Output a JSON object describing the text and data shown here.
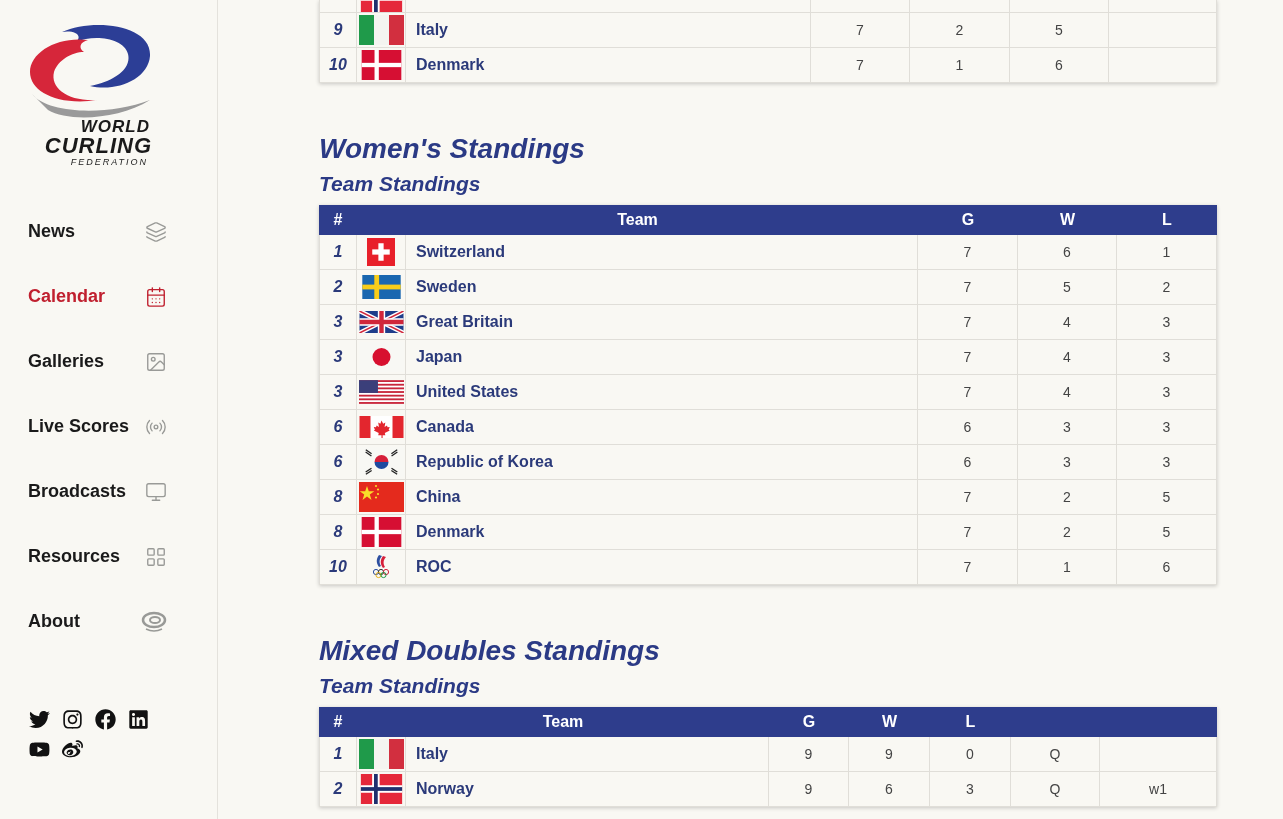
{
  "logo": {
    "line1": "WORLD",
    "line2": "CURLING",
    "line3": "FEDERATION"
  },
  "nav": [
    {
      "label": "News",
      "selected": false
    },
    {
      "label": "Calendar",
      "selected": true
    },
    {
      "label": "Galleries",
      "selected": false
    },
    {
      "label": "Live Scores",
      "selected": false
    },
    {
      "label": "Broadcasts",
      "selected": false
    },
    {
      "label": "Resources",
      "selected": false
    },
    {
      "label": "About",
      "selected": false
    }
  ],
  "men_table": {
    "cut_row": {
      "kind": "no"
    },
    "rows": [
      {
        "kind": "it",
        "cells": [
          "9",
          "Italy",
          "7",
          "2",
          "5"
        ]
      },
      {
        "kind": "dk",
        "cells": [
          "10",
          "Denmark",
          "7",
          "1",
          "6"
        ]
      }
    ]
  },
  "women": {
    "title": "Women's Standings",
    "subtitle": "Team Standings",
    "columns": [
      "#",
      "Team",
      "G",
      "W",
      "L"
    ],
    "rows": [
      {
        "kind": "ch",
        "cells": [
          "1",
          "Switzerland",
          "7",
          "6",
          "1"
        ]
      },
      {
        "kind": "se",
        "cells": [
          "2",
          "Sweden",
          "7",
          "5",
          "2"
        ]
      },
      {
        "kind": "gb",
        "cells": [
          "3",
          "Great Britain",
          "7",
          "4",
          "3"
        ]
      },
      {
        "kind": "jp",
        "cells": [
          "3",
          "Japan",
          "7",
          "4",
          "3"
        ]
      },
      {
        "kind": "us",
        "cells": [
          "3",
          "United States",
          "7",
          "4",
          "3"
        ]
      },
      {
        "kind": "ca",
        "cells": [
          "6",
          "Canada",
          "6",
          "3",
          "3"
        ]
      },
      {
        "kind": "kr",
        "cells": [
          "6",
          "Republic of Korea",
          "6",
          "3",
          "3"
        ]
      },
      {
        "kind": "cn",
        "cells": [
          "8",
          "China",
          "7",
          "2",
          "5"
        ]
      },
      {
        "kind": "dk",
        "cells": [
          "8",
          "Denmark",
          "7",
          "2",
          "5"
        ]
      },
      {
        "kind": "roc",
        "cells": [
          "10",
          "ROC",
          "7",
          "1",
          "6"
        ]
      }
    ]
  },
  "mixed": {
    "title": "Mixed Doubles Standings",
    "subtitle": "Team Standings",
    "columns": [
      "#",
      "Team",
      "G",
      "W",
      "L"
    ],
    "rows": [
      {
        "kind": "it",
        "cells": [
          "1",
          "Italy",
          "9",
          "9",
          "0",
          "Q"
        ]
      },
      {
        "kind": "no",
        "cells": [
          "2",
          "Norway",
          "9",
          "6",
          "3",
          "Q",
          "w1"
        ]
      }
    ]
  }
}
